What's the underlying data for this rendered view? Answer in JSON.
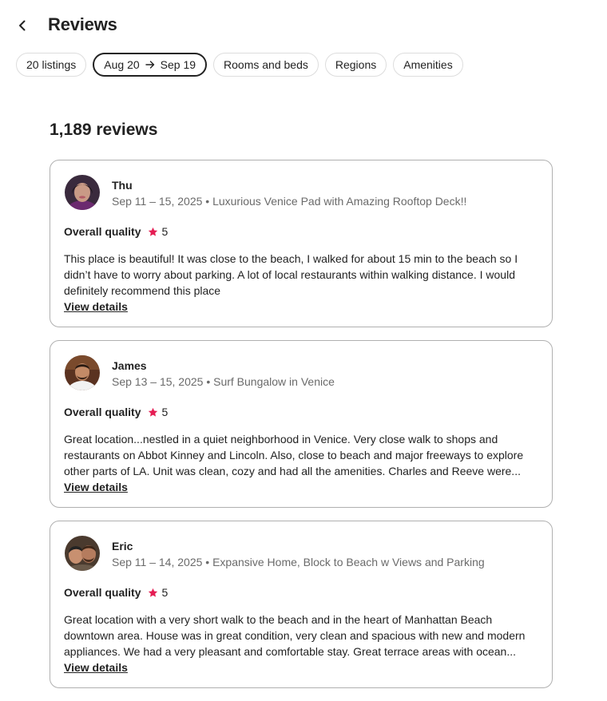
{
  "header": {
    "title": "Reviews",
    "back_icon": "chevron-left-icon"
  },
  "filters": {
    "listings": "20 listings",
    "date_from": "Aug 20",
    "date_to": "Sep 19",
    "rooms": "Rooms and beds",
    "regions": "Regions",
    "amenities": "Amenities"
  },
  "summary": {
    "count": "1,189 reviews"
  },
  "colors": {
    "star": "#e51d53",
    "text": "#222222",
    "muted": "#6a6a6a",
    "border": "#b0b0b0"
  },
  "reviews": [
    {
      "name": "Thu",
      "meta": "Sep 11 – 15, 2025 • Luxurious Venice Pad with Amazing Rooftop Deck!!",
      "rating_label": "Overall quality",
      "rating": "5",
      "text": "This place is beautiful! It was close to the beach, I walked for about 15 min to the beach so I didn’t have to worry about parking. A lot of local restaurants within walking distance. I would definitely recommend this place",
      "link": "View details"
    },
    {
      "name": "James",
      "meta": "Sep 13 – 15, 2025 • Surf Bungalow in Venice",
      "rating_label": "Overall quality",
      "rating": "5",
      "text": "Great location...nestled in a quiet neighborhood in Venice. Very close walk to shops and restaurants on Abbot Kinney and Lincoln. Also, close to beach and major freeways to explore other parts of LA. Unit was clean, cozy and had all the amenities. Charles and Reeve were...",
      "link": "View details"
    },
    {
      "name": "Eric",
      "meta": "Sep 11 – 14, 2025 • Expansive Home, Block to Beach w Views and Parking",
      "rating_label": "Overall quality",
      "rating": "5",
      "text": "Great location with a very short walk to the beach and in the heart of Manhattan Beach downtown area. House was in great condition, very clean and spacious with new and modern appliances. We had a very pleasant and comfortable stay. Great terrace areas with ocean...",
      "link": "View details"
    }
  ]
}
